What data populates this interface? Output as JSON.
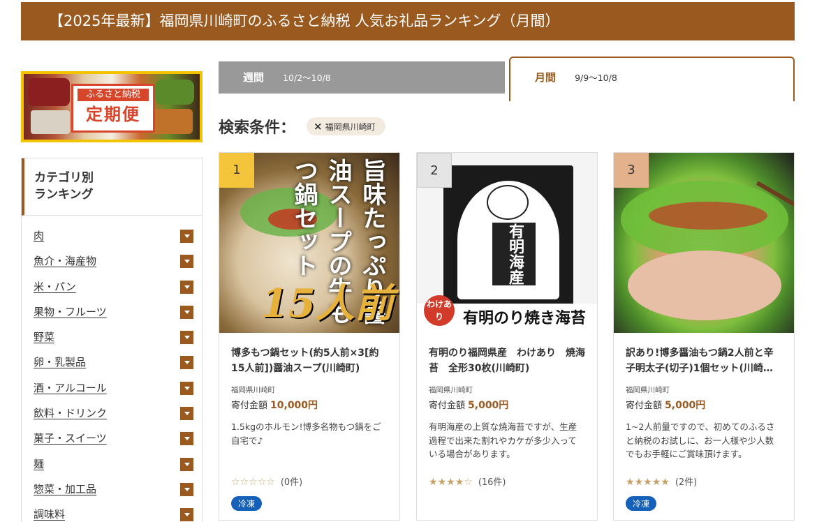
{
  "page": {
    "title": "【2025年最新】福岡県川崎町のふるさと納税 人気お礼品ランキング（月間）"
  },
  "banner": {
    "small": "ふるさと納税",
    "big": "定期便"
  },
  "categories": {
    "heading_line1": "カテゴリ別",
    "heading_line2": "ランキング",
    "items": [
      "肉",
      "魚介・海産物",
      "米・パン",
      "果物・フルーツ",
      "野菜",
      "卵・乳製品",
      "酒・アルコール",
      "飲料・ドリンク",
      "菓子・スイーツ",
      "麺",
      "惣菜・加工品",
      "調味料"
    ]
  },
  "tabs": {
    "weekly": {
      "label": "週間",
      "date": "10/2〜10/8"
    },
    "monthly": {
      "label": "月間",
      "date": "9/9〜10/8"
    }
  },
  "search": {
    "label": "検索条件：",
    "chip_x": "×",
    "chip": "福岡県川崎町"
  },
  "colors": {
    "brand": "#9a5a1f",
    "rank1": "#f4c53a",
    "rank2": "#e5e5e5",
    "rank3": "#e3b18c",
    "frozen_badge": "#1560b8",
    "banner_border": "#f2c400"
  },
  "products": [
    {
      "rank": "1",
      "image_text_vertical": "旨味たっぷり醤油スープの牛もつ鍋セット",
      "image_text_big": "15人前",
      "title": "博多もつ鍋セット(約5人前×3[約15人前])醤油スープ(川崎町)",
      "location": "福岡県川崎町",
      "price_label": "寄付金額",
      "price": "10,000円",
      "description": "1.5kgのホルモン!博多名物もつ鍋をご自宅で♪",
      "stars_on": 0,
      "rating_count": "(0件)",
      "badge": "冷凍"
    },
    {
      "rank": "2",
      "image_text_vertical": "有明海産焼き海苔",
      "image_text_badge": "わけあり",
      "image_text_foot": "有明のり焼き海苔",
      "title": "有明のり福岡県産　わけあり　焼海苔　全形30枚(川崎町)",
      "location": "福岡県川崎町",
      "price_label": "寄付金額",
      "price": "5,000円",
      "description": "有明海産の上質な焼海苔ですが、生産過程で出来た割れやカケが多少入っている場合があります。",
      "stars_on": 4,
      "rating_count": "(16件)",
      "badge": ""
    },
    {
      "rank": "3",
      "title": "訳あり!博多醤油もつ鍋2人前と辛子明太子(切子)1個セット(川崎…",
      "location": "福岡県川崎町",
      "price_label": "寄付金額",
      "price": "5,000円",
      "description": "1~2人前量ですので、初めてのふるさと納税のお試しに、お一人様や少人数でもお手軽にご賞味頂けます。",
      "stars_on": 5,
      "rating_count": "(2件)",
      "badge": "冷凍"
    }
  ]
}
